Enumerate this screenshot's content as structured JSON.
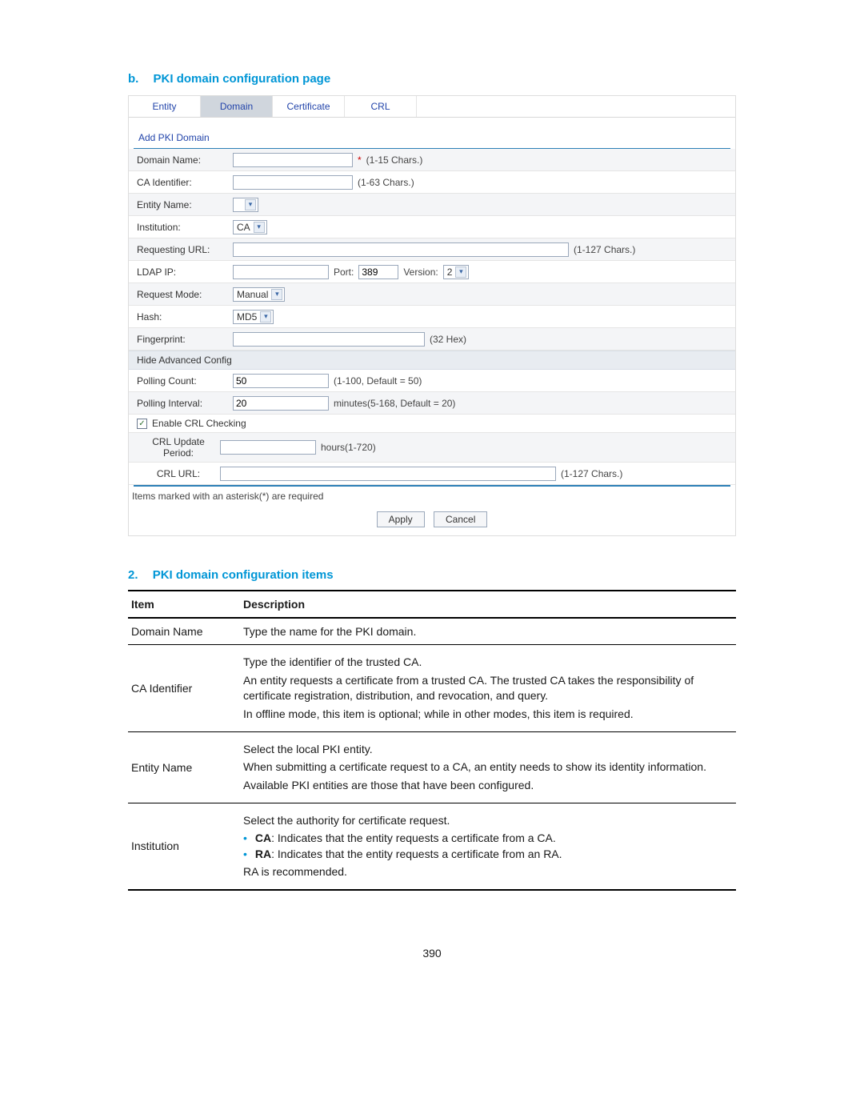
{
  "headings": {
    "b_prefix": "b.",
    "b_text": "PKI domain configuration page",
    "s2_prefix": "2.",
    "s2_text": "PKI domain configuration items"
  },
  "tabs": {
    "entity": "Entity",
    "domain": "Domain",
    "certificate": "Certificate",
    "crl": "CRL"
  },
  "section_link": "Add PKI Domain",
  "form": {
    "domain_name": {
      "label": "Domain Name:",
      "hint": "(1-15 Chars.)",
      "req": "*"
    },
    "ca_identifier": {
      "label": "CA Identifier:",
      "hint": "(1-63 Chars.)"
    },
    "entity_name": {
      "label": "Entity Name:"
    },
    "institution": {
      "label": "Institution:",
      "value": "CA"
    },
    "requesting_url": {
      "label": "Requesting URL:",
      "hint": "(1-127 Chars.)"
    },
    "ldap_ip": {
      "label": "LDAP IP:",
      "port_label": "Port:",
      "port_value": "389",
      "version_label": "Version:",
      "version_value": "2"
    },
    "request_mode": {
      "label": "Request Mode:",
      "value": "Manual"
    },
    "hash": {
      "label": "Hash:",
      "value": "MD5"
    },
    "fingerprint": {
      "label": "Fingerprint:",
      "hint": "(32 Hex)"
    },
    "adv_toggle": "Hide Advanced Config",
    "polling_count": {
      "label": "Polling Count:",
      "value": "50",
      "hint": "(1-100, Default = 50)"
    },
    "polling_interval": {
      "label": "Polling Interval:",
      "value": "20",
      "hint": "minutes(5-168, Default = 20)"
    },
    "enable_crl": "Enable CRL Checking",
    "crl_update": {
      "label": "CRL Update Period:",
      "hint": "hours(1-720)"
    },
    "crl_url": {
      "label": "CRL URL:",
      "hint": "(1-127 Chars.)"
    },
    "footer_note": "Items marked with an asterisk(*) are required",
    "apply": "Apply",
    "cancel": "Cancel"
  },
  "table": {
    "h_item": "Item",
    "h_desc": "Description",
    "r1_item": "Domain Name",
    "r1_desc": "Type the name for the PKI domain.",
    "r2_item": "CA Identifier",
    "r2_p1": "Type the identifier of the trusted CA.",
    "r2_p2": "An entity requests a certificate from a trusted CA. The trusted CA takes the responsibility of certificate registration, distribution, and revocation, and query.",
    "r2_p3": "In offline mode, this item is optional; while in other modes, this item is required.",
    "r3_item": "Entity Name",
    "r3_p1": "Select the local PKI entity.",
    "r3_p2": "When submitting a certificate request to a CA, an entity needs to show its identity information.",
    "r3_p3": "Available PKI entities are those that have been configured.",
    "r4_item": "Institution",
    "r4_p1": "Select the authority for certificate request.",
    "r4_b1_strong": "CA",
    "r4_b1_rest": ": Indicates that the entity requests a certificate from a CA.",
    "r4_b2_strong": "RA",
    "r4_b2_rest": ": Indicates that the entity requests a certificate from an RA.",
    "r4_p2": "RA is recommended."
  },
  "page_number": "390"
}
